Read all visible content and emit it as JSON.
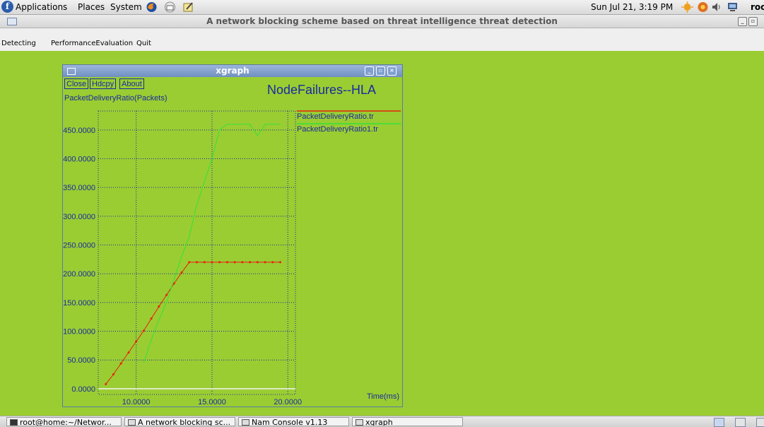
{
  "top_panel": {
    "menus": [
      "Applications",
      "Places",
      "System"
    ],
    "clock": "Sun Jul 21,  3:19 PM",
    "user": "roo"
  },
  "main_window": {
    "title": "A network blocking scheme based on threat intelligence threat detection",
    "menu": [
      "Detecting",
      "PerformanceEvaluation",
      "Quit"
    ]
  },
  "xgraph": {
    "window_title": "xgraph",
    "buttons": [
      "Close",
      "Hdcpy",
      "About"
    ],
    "y_axis_title": "PacketDeliveryRatio(Packets)",
    "graph_title": "NodeFailures--HLA",
    "x_axis_title": "Time(ms)"
  },
  "chart_data": {
    "type": "line",
    "title": "NodeFailures--HLA",
    "xlabel": "Time(ms)",
    "ylabel": "PacketDeliveryRatio(Packets)",
    "xlim": [
      7.5,
      20.5
    ],
    "ylim": [
      -10,
      483
    ],
    "x_ticks": [
      "10.0000",
      "15.0000",
      "20.0000"
    ],
    "y_ticks": [
      "0.0000",
      "50.0000",
      "100.0000",
      "150.0000",
      "200.0000",
      "250.0000",
      "300.0000",
      "350.0000",
      "400.0000",
      "450.0000"
    ],
    "x_tick_values": [
      10,
      15,
      20
    ],
    "y_tick_values": [
      0,
      50,
      100,
      150,
      200,
      250,
      300,
      350,
      400,
      450
    ],
    "grid": true,
    "legend_position": "right",
    "series": [
      {
        "name": "PacketDeliveryRatio.tr",
        "color": "#e8200c",
        "markers": true,
        "x": [
          8.0,
          8.5,
          9.0,
          9.5,
          10.0,
          10.5,
          11.0,
          11.5,
          12.0,
          12.5,
          13.0,
          13.5,
          14.0,
          14.5,
          15.0,
          15.5,
          16.0,
          16.5,
          17.0,
          17.5,
          18.0,
          18.5,
          19.0,
          19.5
        ],
        "values": [
          8,
          25,
          44,
          63,
          82,
          101,
          122,
          143,
          163,
          183,
          202,
          220,
          220,
          220,
          220,
          220,
          220,
          220,
          220,
          220,
          220,
          220,
          220,
          220
        ]
      },
      {
        "name": "PacketDeliveryRatio1.tr",
        "color": "#33e13a",
        "markers": false,
        "x": [
          10.5,
          11.0,
          11.5,
          12.0,
          12.5,
          13.0,
          13.5,
          14.0,
          14.5,
          15.0,
          15.5,
          16.0,
          16.5,
          17.0,
          17.5,
          18.0,
          18.5,
          19.0,
          19.5
        ],
        "values": [
          45,
          85,
          120,
          150,
          190,
          230,
          265,
          320,
          360,
          400,
          450,
          460,
          460,
          460,
          460,
          440,
          460,
          460,
          460
        ]
      }
    ]
  },
  "taskbar": {
    "tasks": [
      "root@home:~/Networ...",
      "A network blocking sc...",
      "Nam Console v1.13",
      "xgraph"
    ]
  },
  "colors": {
    "desktop_bg": "#9acd32",
    "axis_text": "#1a2aa0",
    "grid": "#1a2aa0"
  }
}
